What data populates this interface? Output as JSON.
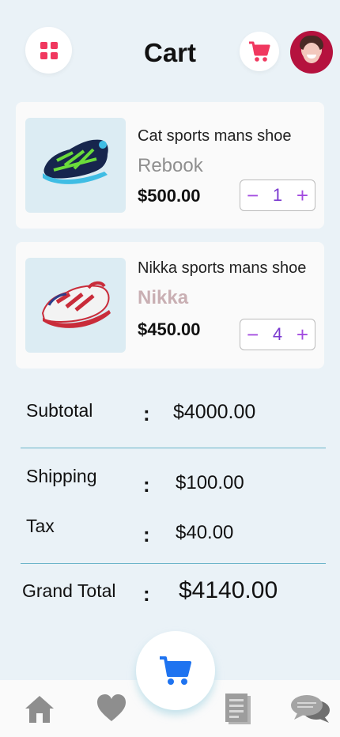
{
  "header": {
    "title": "Cart"
  },
  "items": [
    {
      "name": "Cat sports mans shoe",
      "brand": "Rebook",
      "brand_color": "#8f8f8f",
      "price": "$500.00",
      "quantity": "1"
    },
    {
      "name": "Nikka sports mans shoe",
      "brand": "Nikka",
      "brand_color": "#c9afb3",
      "price": "$450.00",
      "quantity": "4"
    }
  ],
  "summary": {
    "subtotal_label": "Subtotal",
    "subtotal_value": "$4000.00",
    "shipping_label": "Shipping",
    "shipping_value": "$100.00",
    "tax_label": "Tax",
    "tax_value": "$40.00",
    "grand_total_label": "Grand Total",
    "grand_total_value": "$4140.00",
    "separator": ":"
  },
  "nav": {
    "items": [
      "home-icon",
      "heart-icon",
      "cart-icon",
      "document-icon",
      "chat-icon"
    ]
  },
  "colors": {
    "accent_pink": "#f0385f",
    "accent_purple": "#a34ce0",
    "accent_blue": "#1e73f0",
    "divider": "#6ab4c9"
  }
}
